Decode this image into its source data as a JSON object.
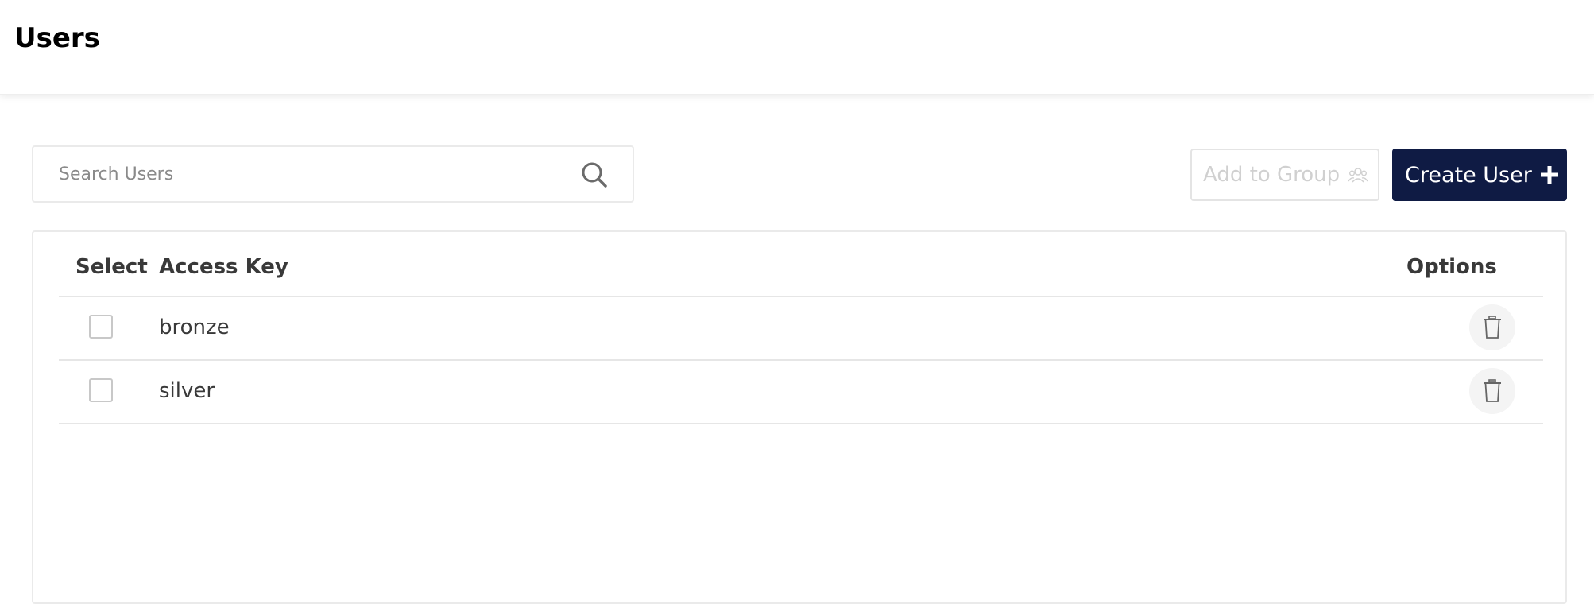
{
  "header": {
    "title": "Users"
  },
  "search": {
    "placeholder": "Search Users",
    "value": "",
    "icon": "search-icon"
  },
  "actions": {
    "add_to_group": {
      "label": "Add to Group",
      "icon": "group-icon",
      "disabled": true
    },
    "create_user": {
      "label": "Create User",
      "icon": "plus-icon",
      "color": "#0f1b44"
    }
  },
  "table": {
    "columns": {
      "select": "Select",
      "access_key": "Access Key",
      "options": "Options"
    },
    "rows": [
      {
        "access_key": "bronze",
        "selected": false,
        "option_icon": "trash-icon"
      },
      {
        "access_key": "silver",
        "selected": false,
        "option_icon": "trash-icon"
      }
    ]
  }
}
